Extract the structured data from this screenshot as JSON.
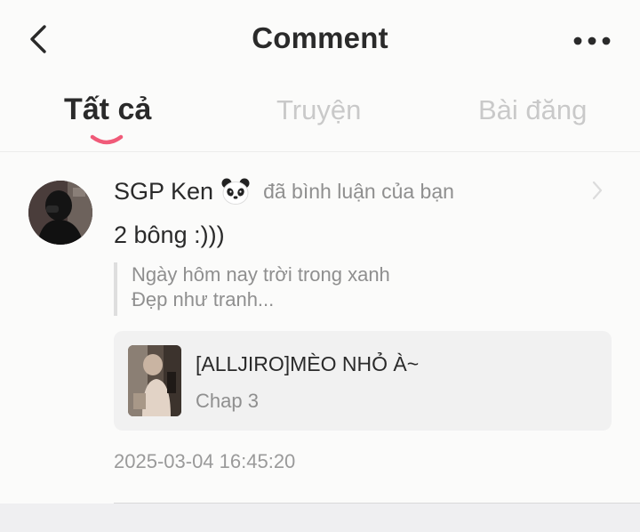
{
  "header": {
    "title": "Comment",
    "back_icon": "chevron-left-icon",
    "more_icon": "more-horizontal-icon"
  },
  "tabs": [
    {
      "label": "Tất cả",
      "active": true
    },
    {
      "label": "Truyện",
      "active": false
    },
    {
      "label": "Bài đăng",
      "active": false
    }
  ],
  "colors": {
    "accent": "#f05a78",
    "text_primary": "#2a2a2a",
    "text_secondary": "#8f8f8f",
    "tab_inactive": "#c9c9c9"
  },
  "notification": {
    "user_name": "SGP Ken",
    "user_badge_icon": "panda-icon",
    "action_text": "đã bình luận của bạn",
    "comment": "2 bông :)))",
    "quoted_lines": [
      "Ngày hôm nay trời trong xanh",
      "Đẹp như tranh..."
    ],
    "story": {
      "title": "[ALLJIRO]MÈO NHỎ À~",
      "chapter": "Chap 3"
    },
    "timestamp": "2025-03-04 16:45:20"
  }
}
